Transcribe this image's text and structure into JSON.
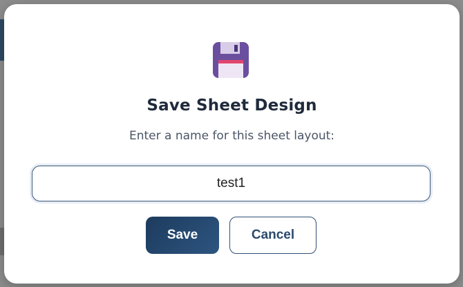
{
  "dialog": {
    "icon": "floppy-disk-icon",
    "title": "Save Sheet Design",
    "subtitle": "Enter a name for this sheet layout:",
    "name_input": {
      "value": "test1",
      "placeholder": ""
    },
    "save_label": "Save",
    "cancel_label": "Cancel"
  },
  "colors": {
    "primary": "#1d3b5e",
    "title_text": "#1f2a3b",
    "subtitle_text": "#4a5566",
    "icon_body": "#6b4f9e",
    "icon_stripe": "#e0456d"
  }
}
